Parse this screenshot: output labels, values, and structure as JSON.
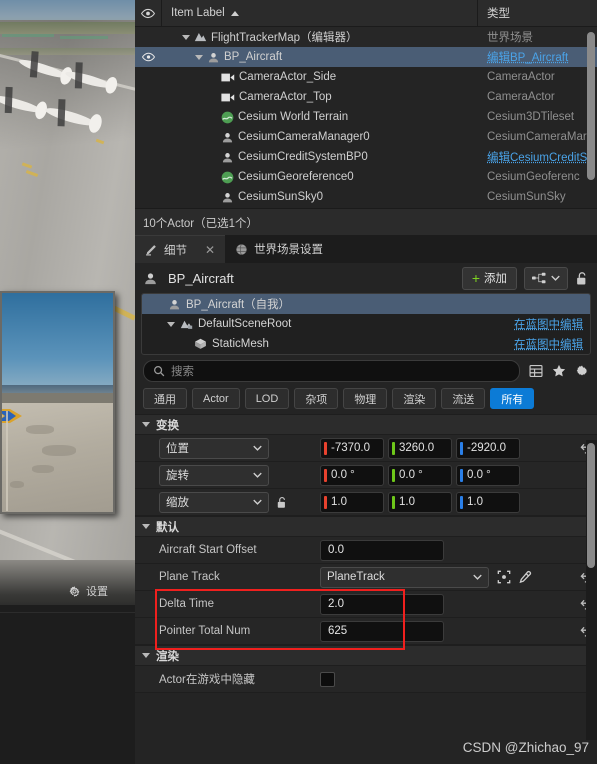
{
  "outliner": {
    "columns": {
      "eye": "eye-icon",
      "label": "Item Label",
      "sort": "▲",
      "type": "类型"
    },
    "rows": [
      {
        "label": "FlightTrackerMap（编辑器）",
        "type": "世界场景",
        "indent": 1,
        "icon": "map-icon",
        "expander": "down",
        "eye": false,
        "selected": false,
        "world": true,
        "link": false
      },
      {
        "label": "BP_Aircraft",
        "type": "编辑BP_Aircraft",
        "indent": 2,
        "icon": "actor-icon",
        "expander": "down",
        "eye": true,
        "selected": true,
        "world": false,
        "link": true
      },
      {
        "label": "CameraActor_Side",
        "type": "CameraActor",
        "indent": 3,
        "icon": "camera-icon",
        "expander": "none",
        "eye": false,
        "selected": false,
        "world": false,
        "link": false
      },
      {
        "label": "CameraActor_Top",
        "type": "CameraActor",
        "indent": 3,
        "icon": "camera-icon",
        "expander": "none",
        "eye": false,
        "selected": false,
        "world": false,
        "link": false
      },
      {
        "label": "Cesium World Terrain",
        "type": "Cesium3DTileset",
        "indent": 3,
        "icon": "cesium-icon",
        "expander": "none",
        "eye": false,
        "selected": false,
        "world": false,
        "link": false
      },
      {
        "label": "CesiumCameraManager0",
        "type": "CesiumCameraMar",
        "indent": 3,
        "icon": "actor-icon",
        "expander": "none",
        "eye": false,
        "selected": false,
        "world": false,
        "link": false
      },
      {
        "label": "CesiumCreditSystemBP0",
        "type": "编辑CesiumCreditS",
        "indent": 3,
        "icon": "actor-icon",
        "expander": "none",
        "eye": false,
        "selected": false,
        "world": false,
        "link": true
      },
      {
        "label": "CesiumGeoreference0",
        "type": "CesiumGeoferenc",
        "indent": 3,
        "icon": "cesium-icon",
        "expander": "none",
        "eye": false,
        "selected": false,
        "world": false,
        "link": false
      },
      {
        "label": "CesiumSunSky0",
        "type": "CesiumSunSky",
        "indent": 3,
        "icon": "actor-icon",
        "expander": "none",
        "eye": false,
        "selected": false,
        "world": false,
        "link": false
      }
    ],
    "status": "10个Actor（已选1个）"
  },
  "details": {
    "tabs": [
      {
        "label": "细节",
        "icon": "details-icon",
        "active": true,
        "closable": true,
        "close": "✕"
      },
      {
        "label": "世界场景设置",
        "icon": "globe-icon",
        "active": false,
        "closable": false,
        "close": ""
      }
    ],
    "object_title": "BP_Aircraft",
    "add_button": "添加",
    "add_plus": "+",
    "component_tree": [
      {
        "label": "BP_Aircraft（自我）",
        "indent": 0,
        "icon": "actor-icon",
        "expander": "none",
        "selected": true,
        "right": ""
      },
      {
        "label": "DefaultSceneRoot",
        "indent": 1,
        "icon": "scene-root-icon",
        "expander": "down",
        "selected": false,
        "right": "在蓝图中编辑"
      },
      {
        "label": "StaticMesh",
        "indent": 2,
        "icon": "mesh-icon",
        "expander": "none",
        "selected": false,
        "right": "在蓝图中编辑"
      }
    ],
    "search": {
      "placeholder": "搜索",
      "icon": "search-icon"
    },
    "search_tools": [
      "grid-view-icon",
      "favorite-star-icon",
      "settings-gear-icon"
    ],
    "filters": [
      {
        "label": "通用",
        "active": false
      },
      {
        "label": "Actor",
        "active": false
      },
      {
        "label": "LOD",
        "active": false
      },
      {
        "label": "杂项",
        "active": false
      },
      {
        "label": "物理",
        "active": false
      },
      {
        "label": "渲染",
        "active": false
      },
      {
        "label": "流送",
        "active": false
      },
      {
        "label": "所有",
        "active": true
      }
    ],
    "sections": [
      {
        "name": "变换",
        "rows": [
          {
            "kind": "vector",
            "label": "位置",
            "dropdown": true,
            "lock": false,
            "values": [
              "-7370.0",
              "3260.0",
              "-2920.0"
            ],
            "revert": true
          },
          {
            "kind": "vector",
            "label": "旋转",
            "dropdown": true,
            "lock": false,
            "values": [
              "0.0 °",
              "0.0 °",
              "0.0 °"
            ],
            "revert": false
          },
          {
            "kind": "vector",
            "label": "缩放",
            "dropdown": true,
            "lock": true,
            "values": [
              "1.0",
              "1.0",
              "1.0"
            ],
            "revert": false
          }
        ]
      },
      {
        "name": "默认",
        "rows": [
          {
            "kind": "number",
            "label": "Aircraft Start Offset",
            "value": "0.0",
            "revert": false,
            "highlight": false
          },
          {
            "kind": "object",
            "label": "Plane Track",
            "value": "PlaneTrack",
            "revert": true,
            "highlight": false
          },
          {
            "kind": "number",
            "label": "Delta Time",
            "value": "2.0",
            "revert": true,
            "highlight": true
          },
          {
            "kind": "number",
            "label": "Pointer Total Num",
            "value": "625",
            "revert": true,
            "highlight": true
          }
        ]
      },
      {
        "name": "渲染",
        "rows": [
          {
            "kind": "checkbox",
            "label": "Actor在游戏中隐藏",
            "value": "",
            "revert": false,
            "highlight": false
          }
        ]
      }
    ],
    "axis_colors": {
      "x": "#e8422e",
      "y": "#6ec71a",
      "z": "#2a7fe8"
    },
    "accent_color": "#0c7bd6",
    "link_color": "#4aa3e8",
    "highlight_color": "#f0201e"
  },
  "viewport": {
    "settings_label": "设置",
    "settings_icon": "gear-icon"
  },
  "watermark": "CSDN @Zhichao_97"
}
